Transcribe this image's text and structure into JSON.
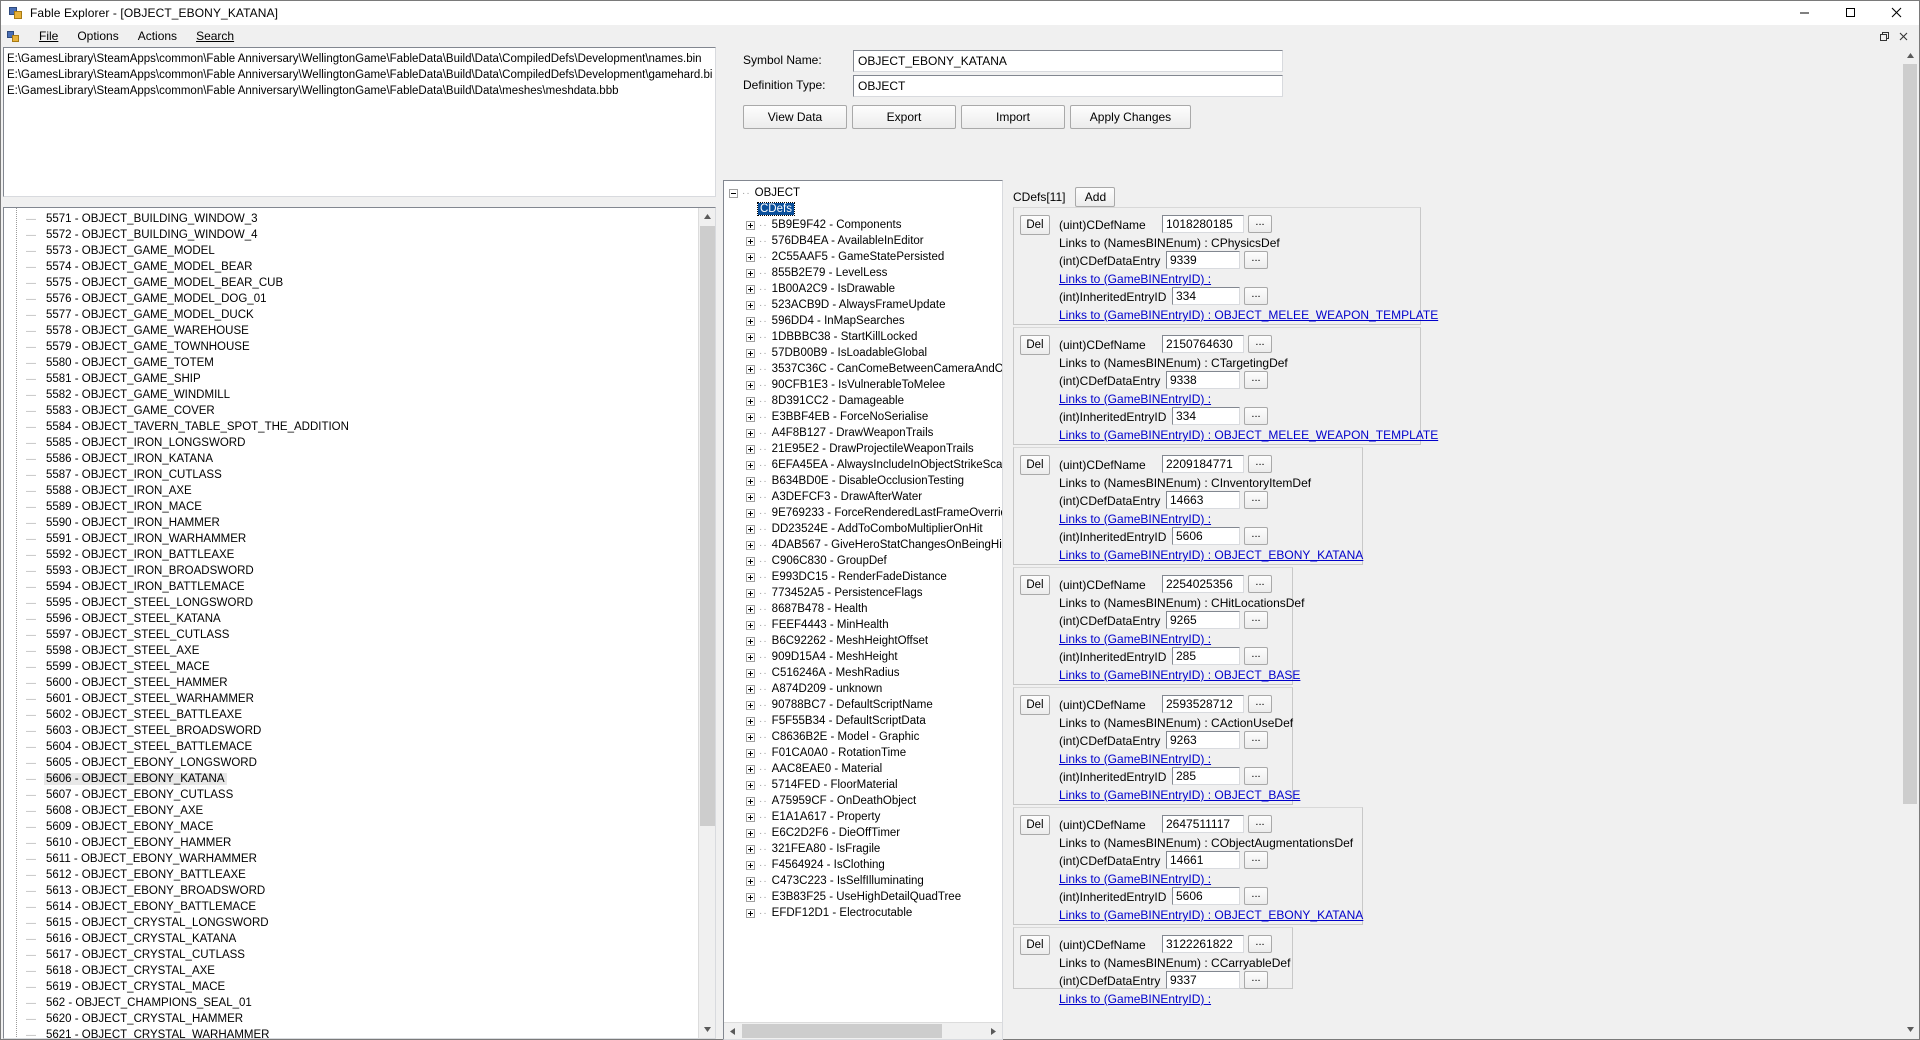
{
  "window": {
    "title": "Fable Explorer - [OBJECT_EBONY_KATANA]",
    "minimize_label": "─",
    "maximize_label": "☐",
    "close_label": "✕"
  },
  "menu": {
    "items": [
      {
        "label": "File"
      },
      {
        "label": "Options"
      },
      {
        "label": "Actions"
      },
      {
        "label": "Search"
      }
    ],
    "mdi": {
      "restore": "❐",
      "close": "✕"
    }
  },
  "paths": [
    "E:\\GamesLibrary\\SteamApps\\common\\Fable Anniversary\\WellingtonGame\\FableData\\Build\\Data\\CompiledDefs\\Development\\names.bin",
    "E:\\GamesLibrary\\SteamApps\\common\\Fable Anniversary\\WellingtonGame\\FableData\\Build\\Data\\CompiledDefs\\Development\\gamehard.bin",
    "E:\\GamesLibrary\\SteamApps\\common\\Fable Anniversary\\WellingtonGame\\FableData\\Build\\Data\\meshes\\meshdata.bbb"
  ],
  "left_tree": {
    "selected_id": "5606",
    "items": [
      {
        "id": "5571",
        "name": "OBJECT_BUILDING_WINDOW_3"
      },
      {
        "id": "5572",
        "name": "OBJECT_BUILDING_WINDOW_4"
      },
      {
        "id": "5573",
        "name": "OBJECT_GAME_MODEL"
      },
      {
        "id": "5574",
        "name": "OBJECT_GAME_MODEL_BEAR"
      },
      {
        "id": "5575",
        "name": "OBJECT_GAME_MODEL_BEAR_CUB"
      },
      {
        "id": "5576",
        "name": "OBJECT_GAME_MODEL_DOG_01"
      },
      {
        "id": "5577",
        "name": "OBJECT_GAME_MODEL_DUCK"
      },
      {
        "id": "5578",
        "name": "OBJECT_GAME_WAREHOUSE"
      },
      {
        "id": "5579",
        "name": "OBJECT_GAME_TOWNHOUSE"
      },
      {
        "id": "5580",
        "name": "OBJECT_GAME_TOTEM"
      },
      {
        "id": "5581",
        "name": "OBJECT_GAME_SHIP"
      },
      {
        "id": "5582",
        "name": "OBJECT_GAME_WINDMILL"
      },
      {
        "id": "5583",
        "name": "OBJECT_GAME_COVER"
      },
      {
        "id": "5584",
        "name": "OBJECT_TAVERN_TABLE_SPOT_THE_ADDITION"
      },
      {
        "id": "5585",
        "name": "OBJECT_IRON_LONGSWORD"
      },
      {
        "id": "5586",
        "name": "OBJECT_IRON_KATANA"
      },
      {
        "id": "5587",
        "name": "OBJECT_IRON_CUTLASS"
      },
      {
        "id": "5588",
        "name": "OBJECT_IRON_AXE"
      },
      {
        "id": "5589",
        "name": "OBJECT_IRON_MACE"
      },
      {
        "id": "5590",
        "name": "OBJECT_IRON_HAMMER"
      },
      {
        "id": "5591",
        "name": "OBJECT_IRON_WARHAMMER"
      },
      {
        "id": "5592",
        "name": "OBJECT_IRON_BATTLEAXE"
      },
      {
        "id": "5593",
        "name": "OBJECT_IRON_BROADSWORD"
      },
      {
        "id": "5594",
        "name": "OBJECT_IRON_BATTLEMACE"
      },
      {
        "id": "5595",
        "name": "OBJECT_STEEL_LONGSWORD"
      },
      {
        "id": "5596",
        "name": "OBJECT_STEEL_KATANA"
      },
      {
        "id": "5597",
        "name": "OBJECT_STEEL_CUTLASS"
      },
      {
        "id": "5598",
        "name": "OBJECT_STEEL_AXE"
      },
      {
        "id": "5599",
        "name": "OBJECT_STEEL_MACE"
      },
      {
        "id": "5600",
        "name": "OBJECT_STEEL_HAMMER"
      },
      {
        "id": "5601",
        "name": "OBJECT_STEEL_WARHAMMER"
      },
      {
        "id": "5602",
        "name": "OBJECT_STEEL_BATTLEAXE"
      },
      {
        "id": "5603",
        "name": "OBJECT_STEEL_BROADSWORD"
      },
      {
        "id": "5604",
        "name": "OBJECT_STEEL_BATTLEMACE"
      },
      {
        "id": "5605",
        "name": "OBJECT_EBONY_LONGSWORD"
      },
      {
        "id": "5606",
        "name": "OBJECT_EBONY_KATANA"
      },
      {
        "id": "5607",
        "name": "OBJECT_EBONY_CUTLASS"
      },
      {
        "id": "5608",
        "name": "OBJECT_EBONY_AXE"
      },
      {
        "id": "5609",
        "name": "OBJECT_EBONY_MACE"
      },
      {
        "id": "5610",
        "name": "OBJECT_EBONY_HAMMER"
      },
      {
        "id": "5611",
        "name": "OBJECT_EBONY_WARHAMMER"
      },
      {
        "id": "5612",
        "name": "OBJECT_EBONY_BATTLEAXE"
      },
      {
        "id": "5613",
        "name": "OBJECT_EBONY_BROADSWORD"
      },
      {
        "id": "5614",
        "name": "OBJECT_EBONY_BATTLEMACE"
      },
      {
        "id": "5615",
        "name": "OBJECT_CRYSTAL_LONGSWORD"
      },
      {
        "id": "5616",
        "name": "OBJECT_CRYSTAL_KATANA"
      },
      {
        "id": "5617",
        "name": "OBJECT_CRYSTAL_CUTLASS"
      },
      {
        "id": "5618",
        "name": "OBJECT_CRYSTAL_AXE"
      },
      {
        "id": "5619",
        "name": "OBJECT_CRYSTAL_MACE"
      },
      {
        "id": "562",
        "name": "OBJECT_CHAMPIONS_SEAL_01"
      },
      {
        "id": "5620",
        "name": "OBJECT_CRYSTAL_HAMMER"
      },
      {
        "id": "5621",
        "name": "OBJECT_CRYSTAL_WARHAMMER"
      }
    ]
  },
  "form": {
    "symbol_name_label": "Symbol Name:",
    "symbol_name_value": "OBJECT_EBONY_KATANA",
    "definition_type_label": "Definition Type:",
    "definition_type_value": "OBJECT",
    "buttons": [
      {
        "label": "View Data"
      },
      {
        "label": "Export"
      },
      {
        "label": "Import"
      },
      {
        "label": "Apply Changes"
      }
    ]
  },
  "mid_tree": {
    "root": "OBJECT",
    "selected": "CDefs",
    "items": [
      {
        "hash": "5B9E9F42",
        "name": "Components"
      },
      {
        "hash": "576DB4EA",
        "name": "AvailableInEditor"
      },
      {
        "hash": "2C55AAF5",
        "name": "GameStatePersisted"
      },
      {
        "hash": "855B2E79",
        "name": "LevelLess"
      },
      {
        "hash": "1B00A2C9",
        "name": "IsDrawable"
      },
      {
        "hash": "523ACB9D",
        "name": "AlwaysFrameUpdate"
      },
      {
        "hash": "596DD4",
        "name": "InMapSearches"
      },
      {
        "hash": "1DBBBC38",
        "name": "StartKillLocked"
      },
      {
        "hash": "57DB00B9",
        "name": "IsLoadableGlobal"
      },
      {
        "hash": "3537C36C",
        "name": "CanComeBetweenCameraAndObserv"
      },
      {
        "hash": "90CFB1E3",
        "name": "IsVulnerableToMelee"
      },
      {
        "hash": "8D391CC2",
        "name": "Damageable"
      },
      {
        "hash": "E3BBF4EB",
        "name": "ForceNoSerialise"
      },
      {
        "hash": "A4F8B127",
        "name": "DrawWeaponTrails"
      },
      {
        "hash": "21E95E2",
        "name": "DrawProjectileWeaponTrails"
      },
      {
        "hash": "6EFA45EA",
        "name": "AlwaysIncludeInObjectStrikeScans"
      },
      {
        "hash": "B634BD0E",
        "name": "DisableOcclusionTesting"
      },
      {
        "hash": "A3DEFCF3",
        "name": "DrawAfterWater"
      },
      {
        "hash": "9E769233",
        "name": "ForceRenderedLastFrameOverride"
      },
      {
        "hash": "DD23524E",
        "name": "AddToComboMultiplierOnHit"
      },
      {
        "hash": "4DAB567",
        "name": "GiveHeroStatChangesOnBeingHit"
      },
      {
        "hash": "C906C830",
        "name": "GroupDef"
      },
      {
        "hash": "E993DC15",
        "name": "RenderFadeDistance"
      },
      {
        "hash": "773452A5",
        "name": "PersistenceFlags"
      },
      {
        "hash": "8687B478",
        "name": "Health"
      },
      {
        "hash": "FEEF4443",
        "name": "MinHealth"
      },
      {
        "hash": "B6C92262",
        "name": "MeshHeightOffset"
      },
      {
        "hash": "909D15A4",
        "name": "MeshHeight"
      },
      {
        "hash": "C516246A",
        "name": "MeshRadius"
      },
      {
        "hash": "A874D209",
        "name": "unknown"
      },
      {
        "hash": "90788BC7",
        "name": "DefaultScriptName"
      },
      {
        "hash": "F5F55B34",
        "name": "DefaultScriptData"
      },
      {
        "hash": "C8636B2E",
        "name": "Model - Graphic"
      },
      {
        "hash": "F01CA0A0",
        "name": "RotationTime"
      },
      {
        "hash": "AAC8EAE0",
        "name": "Material"
      },
      {
        "hash": "5714FED",
        "name": "FloorMaterial"
      },
      {
        "hash": "A75959CF",
        "name": "OnDeathObject"
      },
      {
        "hash": "E1A1A617",
        "name": "Property"
      },
      {
        "hash": "E6C2D2F6",
        "name": "DieOffTimer"
      },
      {
        "hash": "321FEA80",
        "name": "IsFragile"
      },
      {
        "hash": "F4564924",
        "name": "IsClothing"
      },
      {
        "hash": "C473C223",
        "name": "IsSelfIlluminating"
      },
      {
        "hash": "E3B83F25",
        "name": "UseHighDetailQuadTree"
      },
      {
        "hash": "EFDF12D1",
        "name": "Electrocutable"
      }
    ]
  },
  "cdefs": {
    "header_label": "CDefs[11]",
    "add_label": "Add",
    "del_label": "Del",
    "ellipsis_label": "...",
    "labels": {
      "cdef_name": "(uint)CDefName",
      "links_names": "Links to (NamesBINEnum) :",
      "cdef_data_entry": "(int)CDefDataEntry",
      "links_game": "Links to (GameBINEntryID) :",
      "inherited_entry": "(int)InheritedEntryID"
    },
    "entries": [
      {
        "cdef_name": "1018280185",
        "names_link": "CPhysicsDef",
        "data_entry": "9339",
        "data_link": "",
        "inherited": "334",
        "inherited_link": "Links to (GameBINEntryID) : OBJECT_MELEE_WEAPON_TEMPLATE"
      },
      {
        "cdef_name": "2150764630",
        "names_link": "CTargetingDef",
        "data_entry": "9338",
        "data_link": "",
        "inherited": "334",
        "inherited_link": "Links to (GameBINEntryID) : OBJECT_MELEE_WEAPON_TEMPLATE"
      },
      {
        "cdef_name": "2209184771",
        "names_link": "CInventoryItemDef",
        "data_entry": "14663",
        "data_link": "",
        "inherited": "5606",
        "inherited_link": "Links to (GameBINEntryID) : OBJECT_EBONY_KATANA"
      },
      {
        "cdef_name": "2254025356",
        "names_link": "CHitLocationsDef",
        "data_entry": "9265",
        "data_link": "",
        "inherited": "285",
        "inherited_link": "Links to (GameBINEntryID) : OBJECT_BASE"
      },
      {
        "cdef_name": "2593528712",
        "names_link": "CActionUseDef",
        "data_entry": "9263",
        "data_link": "",
        "inherited": "285",
        "inherited_link": "Links to (GameBINEntryID) : OBJECT_BASE"
      },
      {
        "cdef_name": "2647511117",
        "names_link": "CObjectAugmentationsDef",
        "data_entry": "14661",
        "data_link": "",
        "inherited": "5606",
        "inherited_link": "Links to (GameBINEntryID) : OBJECT_EBONY_KATANA"
      },
      {
        "cdef_name": "3122261822",
        "names_link": "CCarryableDef",
        "data_entry": "9337",
        "data_link": "",
        "inherited": "",
        "inherited_link": ""
      }
    ]
  }
}
